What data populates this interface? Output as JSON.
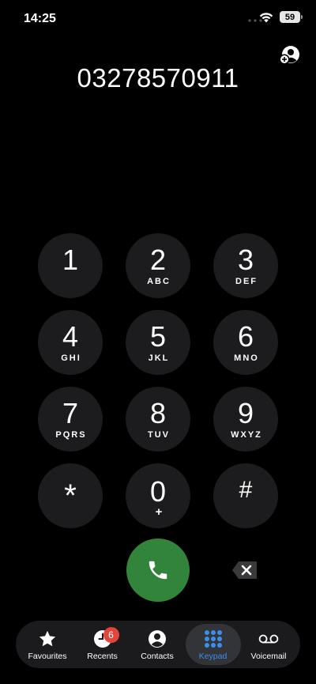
{
  "status_bar": {
    "time": "14:25",
    "battery_level": "59",
    "icons": [
      "wifi-icon",
      "battery-icon"
    ]
  },
  "dialer": {
    "number": "03278570911",
    "add_contact_icon": "add-contact-icon"
  },
  "keypad": [
    {
      "digit": "1",
      "letters": ""
    },
    {
      "digit": "2",
      "letters": "ABC"
    },
    {
      "digit": "3",
      "letters": "DEF"
    },
    {
      "digit": "4",
      "letters": "GHI"
    },
    {
      "digit": "5",
      "letters": "JKL"
    },
    {
      "digit": "6",
      "letters": "MNO"
    },
    {
      "digit": "7",
      "letters": "PQRS"
    },
    {
      "digit": "8",
      "letters": "TUV"
    },
    {
      "digit": "9",
      "letters": "WXYZ"
    },
    {
      "digit": "*",
      "letters": ""
    },
    {
      "digit": "0",
      "letters": "+"
    },
    {
      "digit": "#",
      "letters": ""
    }
  ],
  "actions": {
    "call_icon": "phone-icon",
    "delete_icon": "backspace-icon",
    "call_color": "#32843a"
  },
  "tab_bar": {
    "active": "Keypad",
    "accent_color": "#3a8ef0",
    "tabs": [
      {
        "label": "Favourites",
        "icon": "star-icon"
      },
      {
        "label": "Recents",
        "icon": "clock-icon",
        "badge": "6"
      },
      {
        "label": "Contacts",
        "icon": "person-circle-icon"
      },
      {
        "label": "Keypad",
        "icon": "keypad-grid-icon"
      },
      {
        "label": "Voicemail",
        "icon": "voicemail-icon"
      }
    ]
  }
}
